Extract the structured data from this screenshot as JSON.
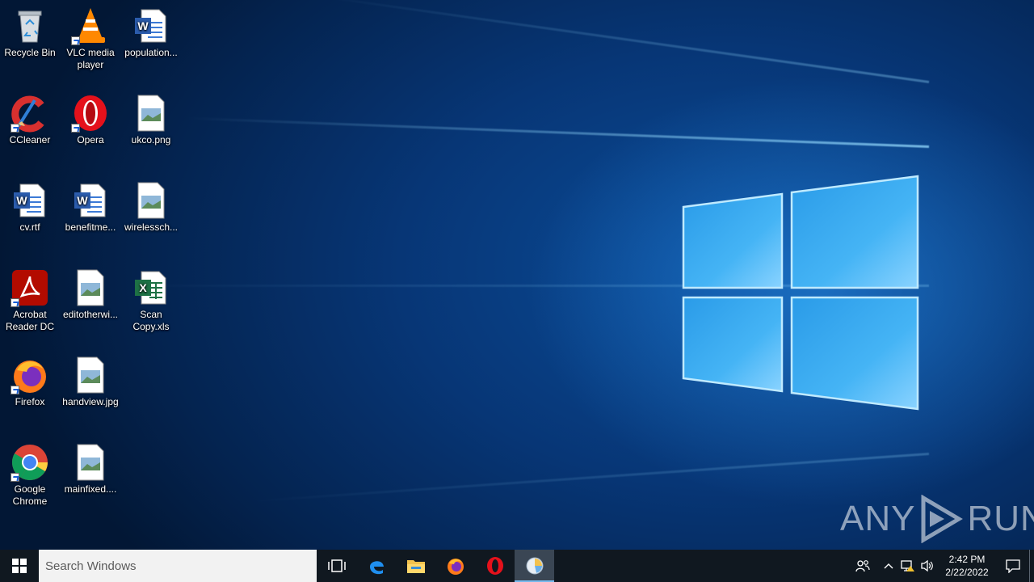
{
  "desktop": {
    "icons": [
      {
        "label": "Recycle Bin",
        "icon": "recycle-bin-icon"
      },
      {
        "label": "VLC media player",
        "icon": "vlc-icon"
      },
      {
        "label": "population...",
        "icon": "word-doc-icon"
      },
      {
        "label": "CCleaner",
        "icon": "ccleaner-icon"
      },
      {
        "label": "Opera",
        "icon": "opera-icon"
      },
      {
        "label": "ukco.png",
        "icon": "image-file-icon"
      },
      {
        "label": "cv.rtf",
        "icon": "word-doc-icon"
      },
      {
        "label": "benefitme...",
        "icon": "word-doc-icon"
      },
      {
        "label": "wirelessch...",
        "icon": "image-file-icon"
      },
      {
        "label": "Acrobat Reader DC",
        "icon": "acrobat-icon"
      },
      {
        "label": "editotherwi...",
        "icon": "image-file-icon"
      },
      {
        "label": "Scan Copy.xls",
        "icon": "excel-icon"
      },
      {
        "label": "Firefox",
        "icon": "firefox-icon"
      },
      {
        "label": "handview.jpg",
        "icon": "image-file-icon"
      },
      {
        "label": "Google Chrome",
        "icon": "chrome-icon"
      },
      {
        "label": "mainfixed....",
        "icon": "image-file-icon"
      }
    ]
  },
  "watermark": {
    "left": "ANY",
    "right": "RUN"
  },
  "taskbar": {
    "search_placeholder": "Search Windows",
    "pinned": [
      "task-view-icon",
      "edge-icon",
      "file-explorer-icon",
      "firefox-icon",
      "opera-icon",
      "active-app-icon"
    ],
    "clock_time": "2:42 PM",
    "clock_date": "2/22/2022"
  },
  "colors": {
    "taskbar": "#101820",
    "accent": "#76b9ed",
    "wallpaper": "#073676"
  }
}
